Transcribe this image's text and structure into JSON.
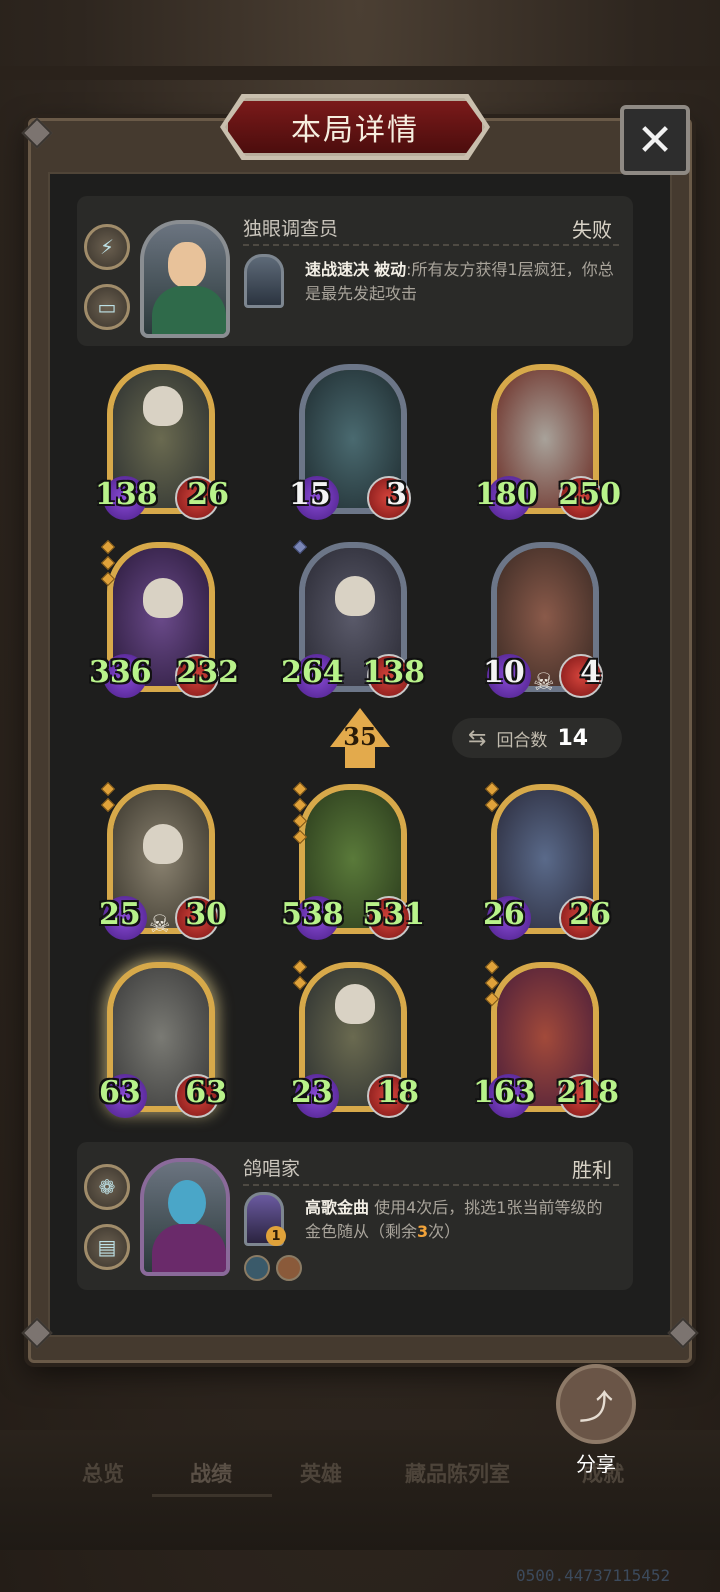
{
  "title": "本局详情",
  "close_icon": "close-icon",
  "top_player": {
    "name": "独眼调查员",
    "result": "失败",
    "skill_name": "速战速决",
    "skill_type": "被动",
    "skill_desc": ":所有友方获得1层疯狂，你总是最先发起攻击"
  },
  "bottom_player": {
    "name": "鸽唱家",
    "result": "胜利",
    "skill_name": "高歌金曲",
    "skill_desc_1": "使用4次后，挑选1张当前等级的金色随从（剩余",
    "skill_remaining": "3",
    "skill_desc_2": "次）",
    "skill_counter": "1"
  },
  "enemy_minions": [
    {
      "atk": "138",
      "hp": "26"
    },
    {
      "atk": "15",
      "hp": "3"
    },
    {
      "atk": "180",
      "hp": "250"
    },
    {
      "atk": "336",
      "hp": "232"
    },
    {
      "atk": "264",
      "hp": "138"
    },
    {
      "atk": "10",
      "hp": "4"
    }
  ],
  "ally_minions": [
    {
      "atk": "25",
      "hp": "30"
    },
    {
      "atk": "538",
      "hp": "531"
    },
    {
      "atk": "26",
      "hp": "26"
    },
    {
      "atk": "63",
      "hp": "63"
    },
    {
      "atk": "23",
      "hp": "18"
    },
    {
      "atk": "163",
      "hp": "218"
    }
  ],
  "tier_value": "35",
  "round_label": "回合数",
  "round_value": "14",
  "share_label": "分享",
  "nav": [
    "总览",
    "战绩",
    "英雄",
    "藏品陈列室",
    "成就"
  ],
  "version": "0500.44737115452"
}
